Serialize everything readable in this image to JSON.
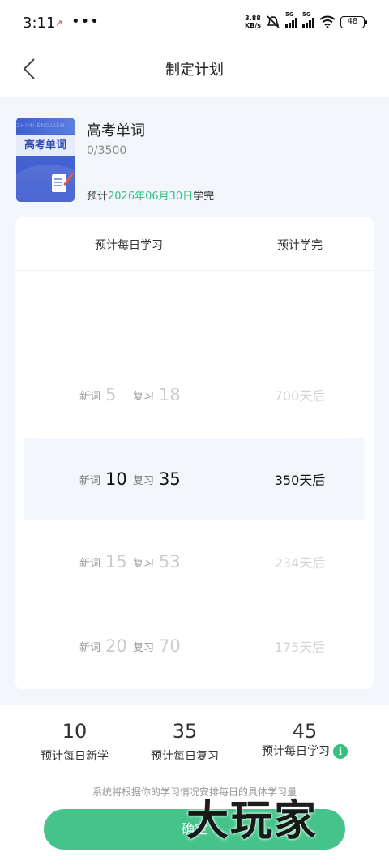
{
  "status": {
    "time": "3:11",
    "net_speed_value": "3.88",
    "net_speed_unit": "KB/s",
    "sim1_label": "5G",
    "sim2_label": "5G",
    "battery": "48"
  },
  "nav": {
    "title": "制定计划"
  },
  "book": {
    "cover_title": "高考单词",
    "cover_brand": "ZHIMI ENGLISH",
    "name": "高考单词",
    "progress": "0/3500",
    "eta_prefix": "预计",
    "eta_date": "2026年06月30日",
    "eta_suffix": "学完"
  },
  "picker": {
    "header_left": "预计每日学习",
    "header_right": "预计学完",
    "new_label": "新词",
    "review_label": "复习",
    "rows": [
      {
        "new": "5",
        "review": "18",
        "days": "700天后",
        "selected": false
      },
      {
        "new": "10",
        "review": "35",
        "days": "350天后",
        "selected": true
      },
      {
        "new": "15",
        "review": "53",
        "days": "234天后",
        "selected": false
      },
      {
        "new": "20",
        "review": "70",
        "days": "175天后",
        "selected": false
      }
    ]
  },
  "stats": {
    "new_value": "10",
    "new_label": "预计每日新学",
    "review_value": "35",
    "review_label": "预计每日复习",
    "total_value": "45",
    "total_label": "预计每日学习"
  },
  "note": "系统将根据你的学习情况安排每日的具体学习量",
  "confirm_label": "确定",
  "watermark": "大玩家",
  "colors": {
    "accent": "#46c38b",
    "eta_green": "#2fbf80",
    "bg": "#f3f6fa"
  }
}
